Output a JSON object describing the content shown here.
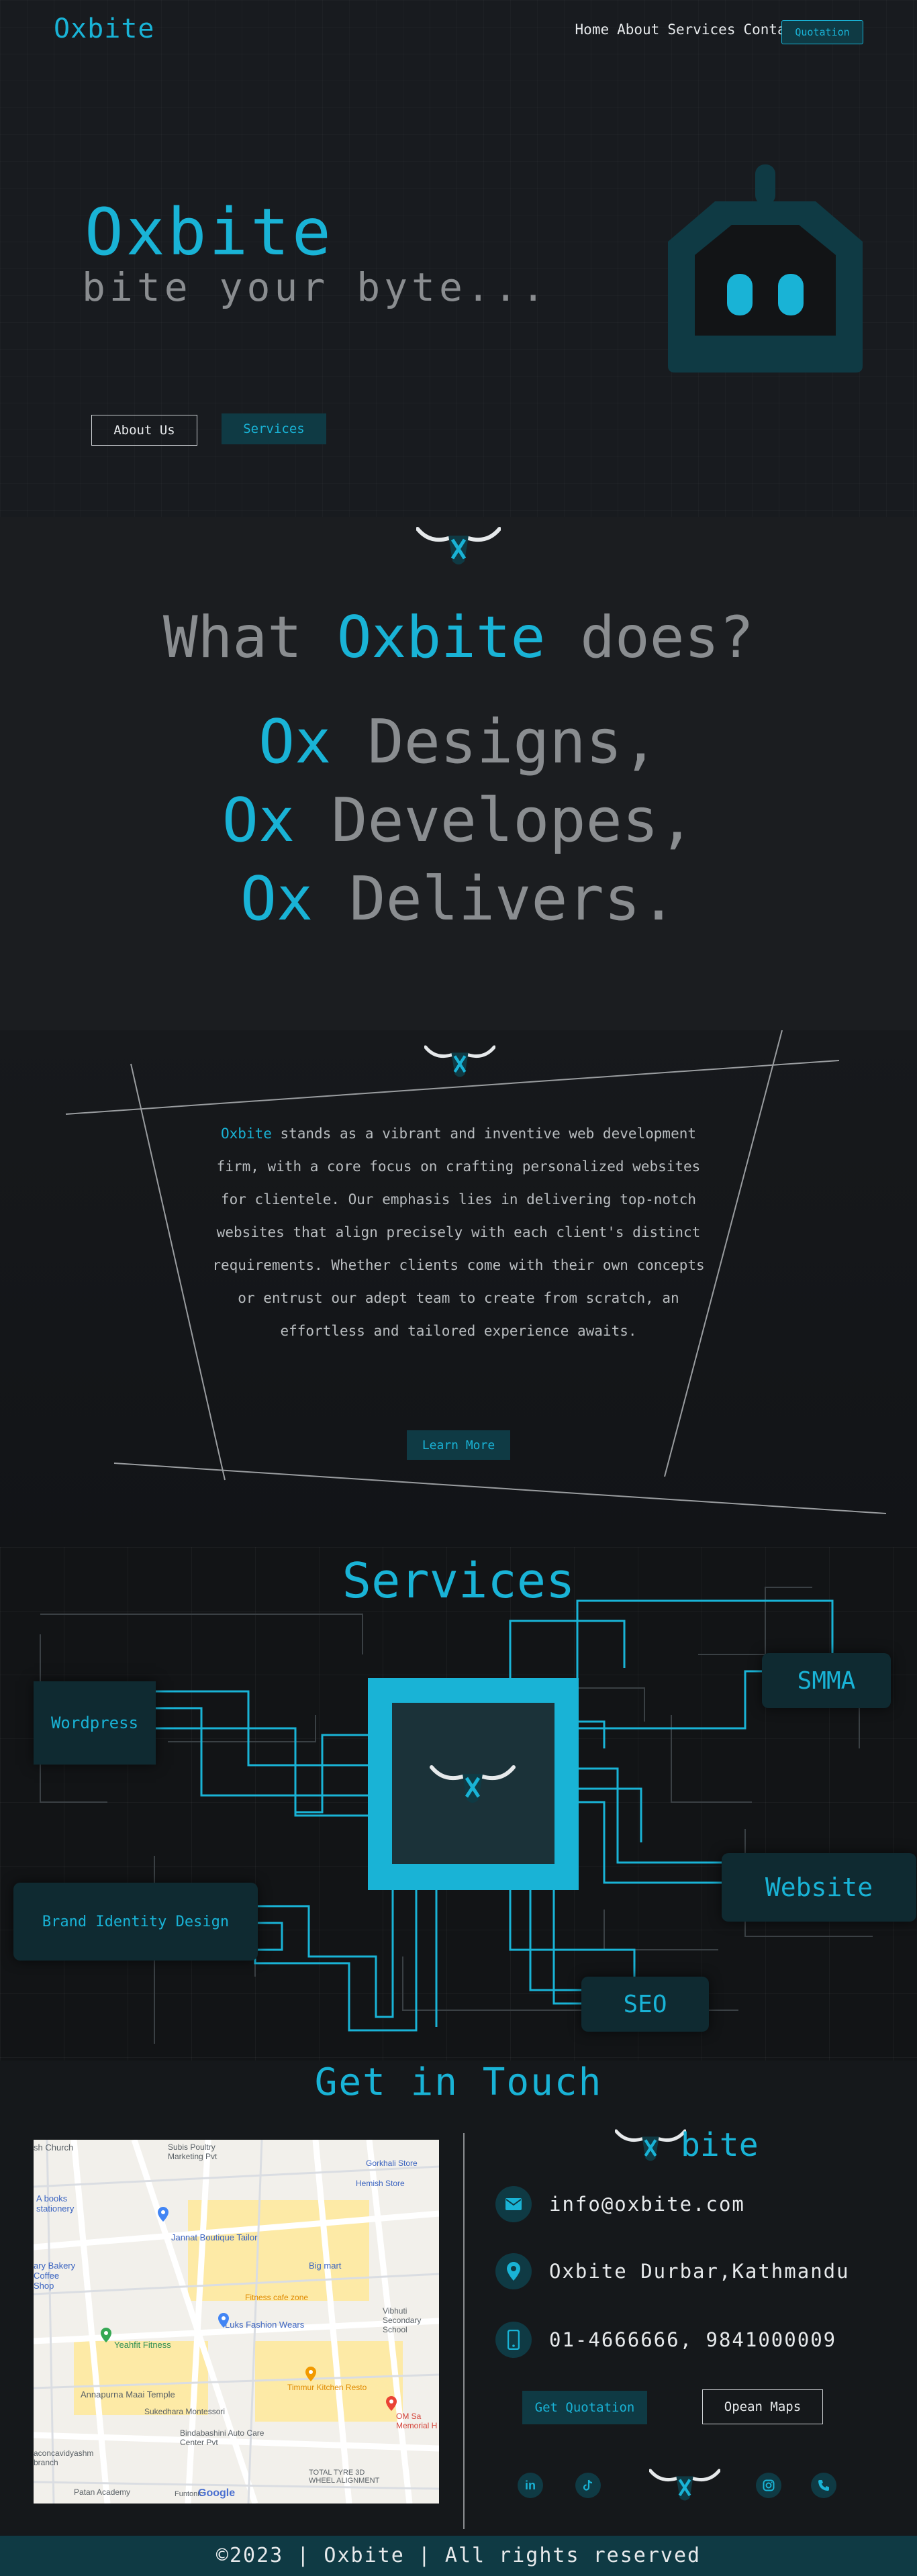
{
  "nav": {
    "logo": "Oxbite",
    "links": [
      "Home",
      "About",
      "Services",
      "Contact"
    ],
    "quote_button": "Quotation"
  },
  "hero": {
    "title": "Oxbite",
    "subtitle": "bite your byte...",
    "about_button": "About Us",
    "services_button": "Services"
  },
  "what": {
    "title_prefix": "What ",
    "title_brand": "Oxbite",
    "title_suffix": " does?",
    "lines": [
      {
        "ox": "Ox",
        "text": " Designs,"
      },
      {
        "ox": "Ox",
        "text": " Developes,"
      },
      {
        "ox": "Ox",
        "text": " Delivers."
      }
    ]
  },
  "about": {
    "brand": "Oxbite",
    "text": " stands as a vibrant and inventive web development firm, with a core focus on crafting personalized websites for clientele. Our emphasis lies in delivering top-notch websites that align precisely with each client's distinct requirements. Whether clients come with their own concepts or entrust our adept team to create from scratch, an effortless and tailored experience awaits.",
    "button": "Learn More"
  },
  "services": {
    "title": "Services",
    "items": {
      "wordpress": "Wordpress",
      "smma": "SMMA",
      "brand": "Brand Identity Design",
      "website": "Website",
      "seo": "SEO"
    }
  },
  "contact": {
    "title": "Get in Touch",
    "brand_suffix": "bite",
    "email": "info@oxbite.com",
    "address": "Oxbite Durbar,Kathmandu",
    "phone": "01-4666666, 9841000009",
    "quote_button": "Get Quotation",
    "maps_button": "Opean Maps",
    "map_labels": {
      "church": "sh Church",
      "subis": "Subis Poultry Marketing Pvt",
      "gorkhali": "Gorkhali Store",
      "hemish": "Hemish Store",
      "abooks": "A books stationery",
      "jannat": "Jannat Boutique Tailor",
      "bakery": "ary Bakery Coffee Shop",
      "bigmart": "Big mart",
      "fitness_cafe": "Fitness cafe zone",
      "luks": "Luks Fashion Wears",
      "vibhuti": "Vibhuti Secondary School",
      "yeahfit": "Yeahfit Fitness",
      "timmur": "Timmur Kitchen Resto",
      "annapurna": "Annapurna Maai Temple",
      "sukedhara": "Sukedhara Montessori",
      "bindabashini": "Bindabashini Auto Care Center Pvt",
      "om": "OM Sa Memorial H",
      "patan": "Patan Academy",
      "tyre": "TOTAL TYRE 3D WHEEL ALIGNMENT",
      "vidya": "aconcavidyashm branch",
      "google": "Google",
      "funtonic": "Funtonic"
    }
  },
  "footer": {
    "text": "©2023 | Oxbite | All rights reserved"
  },
  "colors": {
    "accent": "#19b3d6",
    "dark_teal": "#0f3a44",
    "background": "#15181c"
  },
  "icons": [
    "robot-icon",
    "bull-logo-icon",
    "email-icon",
    "location-icon",
    "phone-icon",
    "linkedin-icon",
    "tiktok-icon",
    "instagram-icon",
    "call-icon",
    "map-pin-icon"
  ]
}
